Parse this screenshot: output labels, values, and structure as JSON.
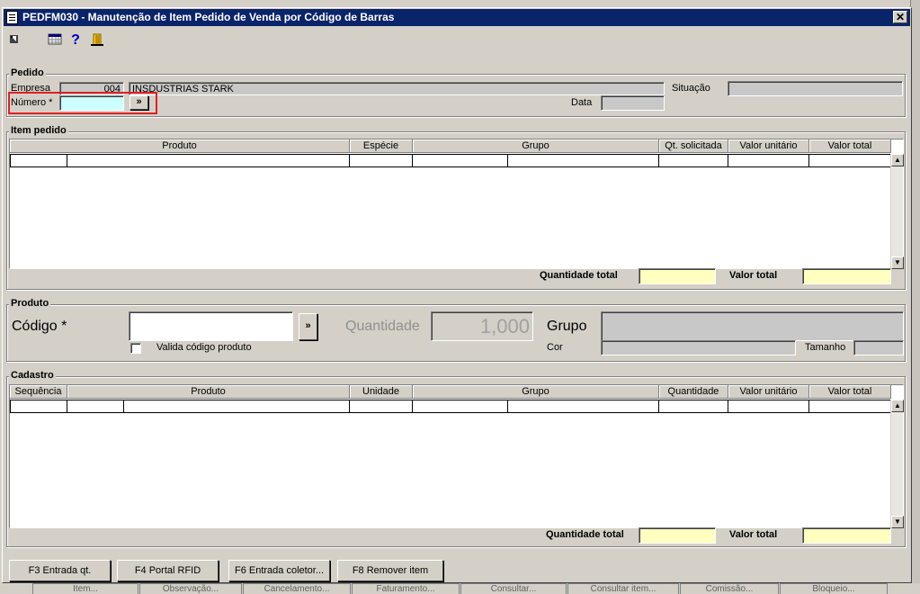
{
  "window": {
    "title": "PEDFM030 - Manutenção de Item Pedido de Venda por Código de Barras",
    "close": "✕"
  },
  "toolbar": {
    "icons": [
      "exit-arrow-icon",
      "calendar-grid-icon",
      "help-icon",
      "door-exit-icon"
    ],
    "help_glyph": "?"
  },
  "pedido": {
    "title": "Pedido",
    "empresa_label": "Empresa",
    "empresa_code": "004",
    "empresa_name": "INSDUSTRIAS STARK",
    "situacao_label": "Situação",
    "situacao_value": "",
    "numero_label": "Número *",
    "numero_value": "",
    "numero_button": "»",
    "data_label": "Data",
    "data_value": ""
  },
  "item_pedido": {
    "title": "Item pedido",
    "columns": [
      "Produto",
      "Espécie",
      "Grupo",
      "Qt. solicitada",
      "Valor unitário",
      "Valor total"
    ],
    "quantidade_total_label": "Quantidade total",
    "valor_total_label": "Valor total",
    "quantidade_total": "",
    "valor_total": ""
  },
  "produto": {
    "title": "Produto",
    "codigo_label": "Código *",
    "codigo_value": "",
    "codigo_button": "»",
    "valida_label": "Valida código produto",
    "valida_checked": false,
    "quantidade_label": "Quantidade",
    "quantidade_value": "1,000",
    "grupo_label": "Grupo",
    "grupo_value": "",
    "cor_label": "Cor",
    "cor_value": "",
    "tamanho_label": "Tamanho",
    "tamanho_value": ""
  },
  "cadastro": {
    "title": "Cadastro",
    "columns": [
      "Sequência",
      "Produto",
      "Unidade",
      "Grupo",
      "Quantidade",
      "Valor unitário",
      "Valor total"
    ],
    "quantidade_total_label": "Quantidade total",
    "valor_total_label": "Valor total",
    "quantidade_total": "",
    "valor_total": ""
  },
  "buttons": {
    "f3": "F3 Entrada qt.",
    "f4": "F4 Portal RFID",
    "f6": "F6 Entrada coletor...",
    "f8": "F8 Remover item"
  },
  "background_tabs": [
    "Item...",
    "Observação...",
    "Cancelamento...",
    "Faturamento...",
    "Consultar...",
    "Consultar item...",
    "Comissão...",
    "Bloqueio..."
  ],
  "colors": {
    "title_bar": "#0a246a",
    "highlight_border": "#e02020",
    "total_field": "#ffffc0",
    "numero_field": "#ccffff"
  }
}
